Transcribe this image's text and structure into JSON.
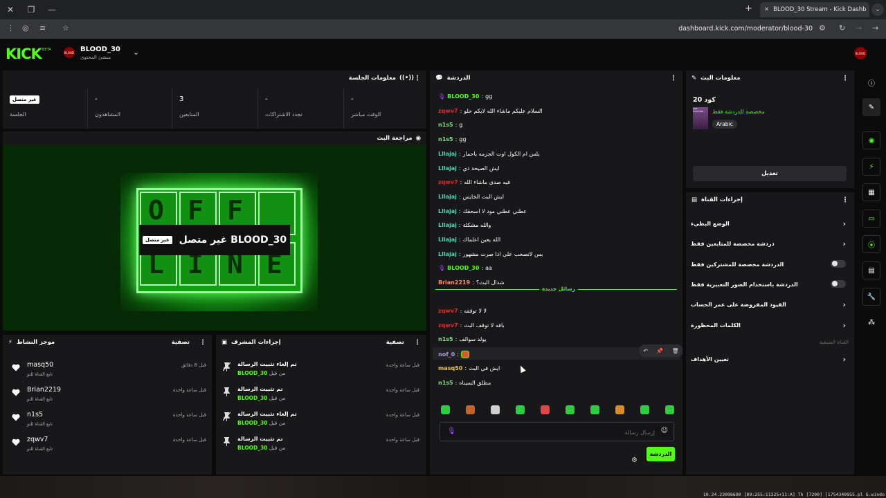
{
  "browser": {
    "tab_title": "BLOOD_30 Stream - Kick Dashb",
    "url": "dashboard.kick.com/moderator/blood-30"
  },
  "header": {
    "logo": "KICK",
    "beta": "BETA",
    "channel_name": "BLOOD_30",
    "channel_role": "منشئ المحتوى",
    "avatar_text": "BLOOD"
  },
  "session": {
    "title": "معلومات الجلسة",
    "stats": [
      {
        "label": "الجلسة",
        "value": "غير متصل"
      },
      {
        "label": "المشاهدون",
        "value": "-"
      },
      {
        "label": "المتابعين",
        "value": "3"
      },
      {
        "label": "تجدد الاشتراكات",
        "value": "-"
      },
      {
        "label": "الوقت مباشر",
        "value": "-"
      }
    ]
  },
  "preview": {
    "title": "مراجعة البث",
    "offline_badge": "غير متصل",
    "offline_text": "غير متصل BLOOD_30",
    "sign_top": [
      "O",
      "F",
      "F",
      ""
    ],
    "sign_bottom": [
      "L",
      "I",
      "N",
      "E"
    ]
  },
  "activity": {
    "title": "موجز النشاط",
    "filter": "تصفية",
    "items": [
      {
        "name": "masq50",
        "sub": "تابع القناة للتو",
        "time": "قبل 8 دقائق"
      },
      {
        "name": "Brian2219",
        "sub": "تابع القناة للتو",
        "time": "قبل ساعة واحدة"
      },
      {
        "name": "n1s5",
        "sub": "تابع القناة للتو",
        "time": "قبل ساعة واحدة"
      },
      {
        "name": "zqwv7",
        "sub": "تابع القناة للتو",
        "time": "قبل ساعة واحدة"
      }
    ]
  },
  "modactions": {
    "title": "إجراءات المشرف",
    "filter": "تصفية",
    "from_suffix": "من قبل",
    "items": [
      {
        "action": "تم إلغاء تثبيت الرسالة",
        "by": "BLOOD_30",
        "time": "قبل ساعة واحدة",
        "icon": "unpin-icon"
      },
      {
        "action": "تم تثبيت الرسالة",
        "by": "BLOOD_30",
        "time": "قبل ساعة واحدة",
        "icon": "pin-icon"
      },
      {
        "action": "تم إلغاء تثبيت الرسالة",
        "by": "BLOOD_30",
        "time": "قبل ساعة واحدة",
        "icon": "unpin-icon"
      },
      {
        "action": "تم تثبيت الرسالة",
        "by": "BLOOD_30",
        "time": "قبل ساعة واحدة",
        "icon": "pin-icon"
      }
    ]
  },
  "chat": {
    "title": "الدردشة",
    "new_messages_label": "رسائل جديدة",
    "input_placeholder": "إرسال رسالة",
    "send_label": "الدردشة",
    "messages_old": [
      {
        "user": "BLOOD_30",
        "text": "gg",
        "color": "#53fc18",
        "mic": true
      },
      {
        "user": "zqwv7",
        "text": "السلام عليكم ماشاء الله لايكم حلو",
        "color": "#e22b2b"
      },
      {
        "user": "n1s5",
        "text": "g",
        "color": "#7ee07e"
      },
      {
        "user": "n1s5",
        "text": "gg",
        "color": "#7ee07e"
      },
      {
        "user": "Lllajaj",
        "text": "يلس ام الكول اوت الجزمه ياحمار",
        "color": "#4fd4b4"
      },
      {
        "user": "Lllajaj",
        "text": "ايش الصيحة ذي",
        "color": "#4fd4b4"
      },
      {
        "user": "zqwv7",
        "text": "فيه صدى ماشاء الله",
        "color": "#e22b2b"
      },
      {
        "user": "Lllajaj",
        "text": "ايش البث الخايس",
        "color": "#4fd4b4"
      },
      {
        "user": "Lllajaj",
        "text": "عطني عطني مود لا اسحقك",
        "color": "#4fd4b4"
      },
      {
        "user": "Lllajaj",
        "text": "والله مشكلة",
        "color": "#4fd4b4"
      },
      {
        "user": "Lllajaj",
        "text": "الله يعين اعلماك",
        "color": "#4fd4b4"
      },
      {
        "user": "Lllajaj",
        "text": "بس لاتصحب علي اذا صرت مشهور",
        "color": "#4fd4b4"
      },
      {
        "user": "BLOOD_30",
        "text": "aa",
        "color": "#53fc18",
        "mic": true
      },
      {
        "user": "Brian2219",
        "text": "شدال البث؟",
        "color": "#ff8a65"
      }
    ],
    "messages_new": [
      {
        "user": "zqwv7",
        "text": "لا لا توقفه",
        "color": "#e22b2b"
      },
      {
        "user": "zqwv7",
        "text": "باقه لا توقف البث",
        "color": "#e22b2b"
      },
      {
        "user": "n1s5",
        "text": "يولد سوالف",
        "color": "#7ee07e"
      },
      {
        "user": "nof_0",
        "text": "",
        "color": "#b39ddb",
        "emote": true
      },
      {
        "user": "masq50",
        "text": "ايش في البث",
        "color": "#e6c54d"
      },
      {
        "user": "n1s5",
        "text": "مطلق السيناه",
        "color": "#7ee07e"
      }
    ]
  },
  "streaminfo": {
    "title": "معلومات البث",
    "stream_title": "كود 20",
    "tag_text": "مخصصة للدردشة فقط",
    "language": "Arabic",
    "edit_label": "تعديل",
    "thumb_text": "JUST CHATTING"
  },
  "channelactions": {
    "title": "إجراءات القناة",
    "items": [
      {
        "label": "الوضع البطيء",
        "type": "chevron"
      },
      {
        "label": "دردشة مخصصة للمتابعين فقط",
        "type": "chevron"
      },
      {
        "label": "الدردشة مخصصة للمشتركين فقط",
        "type": "toggle"
      },
      {
        "label": "الدردشة باستخدام الصور التعبيرية فقط",
        "type": "toggle"
      },
      {
        "label": "القيود المفروضة على عمر الحساب",
        "type": "chevron"
      },
      {
        "label": "الكلمات المحظورة",
        "type": "chevron"
      }
    ],
    "misc_label": "القناة الضيفية",
    "goals_label": "تعيين الأهداف"
  },
  "debug": "10.24.23098690 [89:255:11325+11:A] Th [7200] [1754340955.pl G.windo"
}
